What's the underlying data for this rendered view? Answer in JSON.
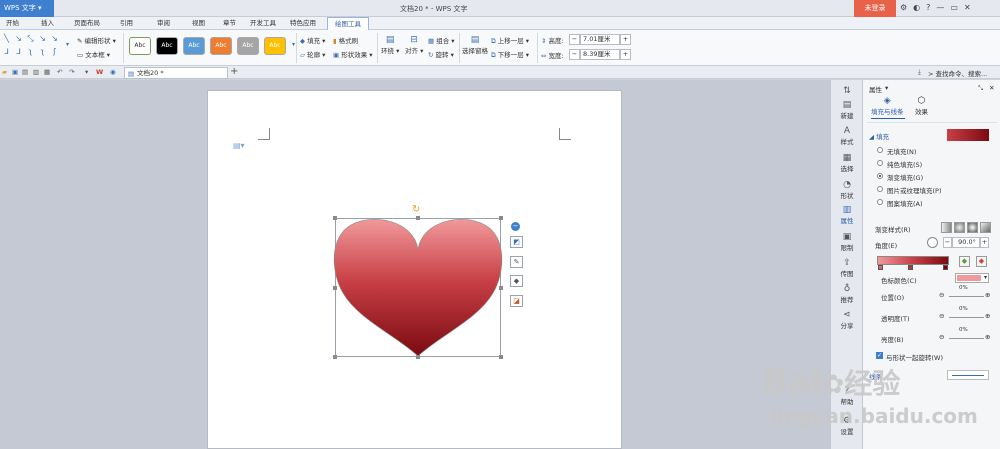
{
  "app": {
    "name": "WPS 文字",
    "title": "文档20 * - WPS 文字",
    "login": "未登录"
  },
  "window_controls": {
    "min": "—",
    "max": "▭",
    "close": "✕"
  },
  "tabs": [
    "开始",
    "插入",
    "页面布局",
    "引用",
    "审阅",
    "视图",
    "章节",
    "开发工具",
    "特色应用",
    "绘图工具"
  ],
  "ribbon": {
    "edit_shape": "编辑形状",
    "text_box": "文本框",
    "styles": [
      "Abc",
      "Abc",
      "Abc",
      "Abc",
      "Abc",
      "Abc"
    ],
    "fill": "填充",
    "format_brush": "格式刷",
    "outline": "轮廓",
    "shape_effect": "形状效果",
    "wrap": "环绕",
    "align": "对齐",
    "group": "组合",
    "rotate": "旋转",
    "select_pane": "选择窗格",
    "bring_forward": "上移一层",
    "send_backward": "下移一层",
    "height_label": "高度:",
    "height_value": "7.01厘米",
    "width_label": "宽度:",
    "width_value": "8.39厘米"
  },
  "quickbar": {
    "search": "查找命令、搜索...",
    "doc_tab": "文档20 *"
  },
  "colors": {
    "accent": "#3f7fcf",
    "login": "#e8624a",
    "heart_top": "#f1999b",
    "heart_bottom": "#7a0a10",
    "swatches": [
      "#ffffff",
      "#000000",
      "#5b9bd5",
      "#ed7d31",
      "#a5a5a5",
      "#ffc000"
    ]
  },
  "vertical_toolbar": [
    "新建",
    "样式",
    "选择",
    "形状",
    "属性",
    "限制",
    "传图",
    "推荐",
    "分享",
    "帮助",
    "设置"
  ],
  "panel": {
    "title": "属性",
    "tab_fill_line": "填充与线条",
    "tab_effect": "效果",
    "section_fill": "填充",
    "fill_options": [
      "无填充(N)",
      "纯色填充(S)",
      "渐变填充(G)",
      "图片或纹理填充(P)",
      "图案填充(A)"
    ],
    "selected_fill": "渐变填充(G)",
    "gradient_style": "渐变样式(R)",
    "angle_label": "角度(E)",
    "angle_value": "90.0°",
    "stop_color_label": "色标颜色(C)",
    "position_label": "位置(O)",
    "position_value": "0%",
    "transparency_label": "透明度(T)",
    "transparency_value": "0%",
    "brightness_label": "亮度(B)",
    "brightness_value": "0%",
    "rotate_with_shape": "与形状一起旋转(W)",
    "line_label": "线条"
  },
  "watermark": {
    "brand": "Bai",
    "brand2": "经验",
    "url": "jingyan.baidu.com"
  }
}
